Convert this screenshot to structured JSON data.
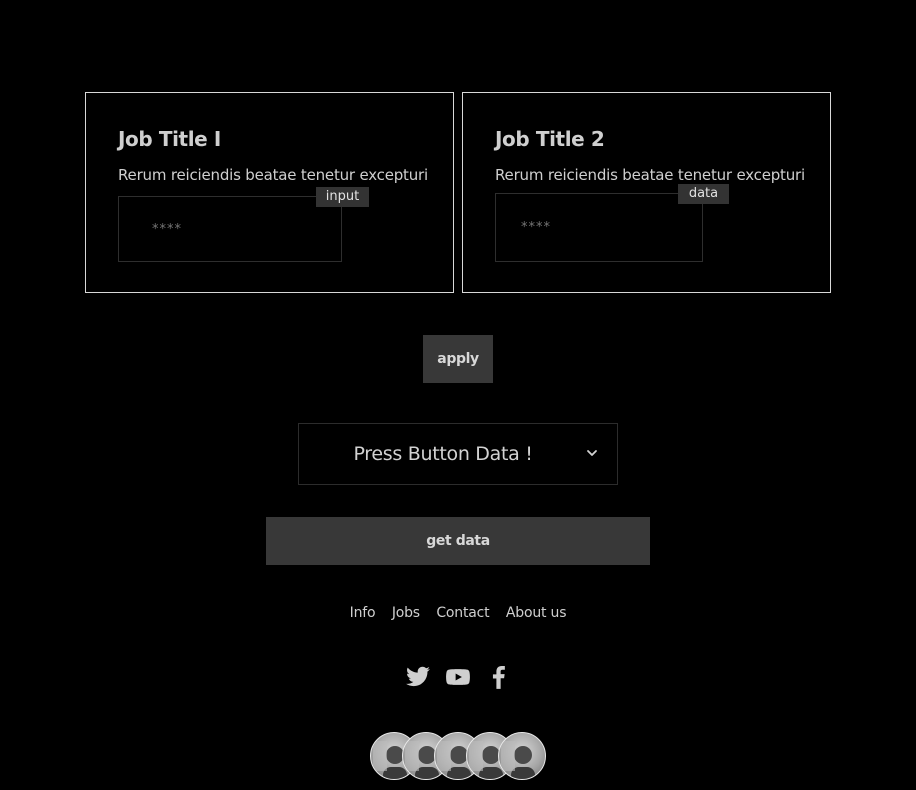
{
  "cards": [
    {
      "title": "Job Title I",
      "description": "Rerum reiciendis beatae tenetur excepturi",
      "field": {
        "placeholder": "****",
        "tag": "input"
      }
    },
    {
      "title": "Job Title 2",
      "description": "Rerum reiciendis beatae tenetur excepturi",
      "field": {
        "placeholder": "****",
        "tag": "data"
      }
    }
  ],
  "apply_label": "apply",
  "select": {
    "value": "Press Button Data !"
  },
  "get_data_label": "get data",
  "footer": {
    "links": [
      "Info",
      "Jobs",
      "Contact",
      "About us"
    ]
  },
  "social_icons": [
    "twitter-icon",
    "youtube-icon",
    "facebook-icon"
  ],
  "avatar_count": 5,
  "colors": {
    "background": "#000000",
    "button": "#383838",
    "text": "#cfcfcf",
    "card_border": "#d8d8d8"
  }
}
